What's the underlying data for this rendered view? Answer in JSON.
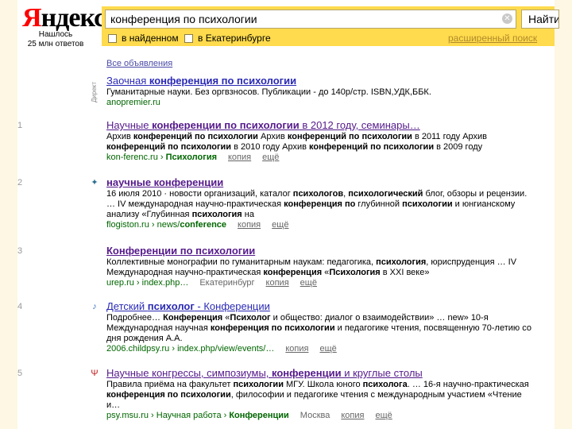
{
  "header": {
    "logo_first": "Я",
    "logo_rest": "ндекс",
    "found_line1": "Нашлось",
    "found_line2": "25 млн ответов",
    "search_value": "конференция по психологии",
    "clear_glyph": "✕",
    "search_button": "Найти",
    "filter_found": "в найденном",
    "filter_city": "в Екатеринбурге",
    "advanced": "расширенный поиск"
  },
  "ads": {
    "all_ads": "Все объявления",
    "label": "Директ",
    "item": {
      "title_pre": "Заочная ",
      "title_bold": "конференция по психологии",
      "snippet": "Гуманитарные науки. Без оргвзносов. Публикации - до 140р/стр. ISBN,УДК,ББК.",
      "url": "anopremier.ru"
    }
  },
  "results": [
    {
      "num": "1",
      "title_pre": "Научные ",
      "title_bold": "конференции по психологии",
      "title_post": " в 2012 году, семинары…",
      "snippet_parts": [
        {
          "t": "Архив ",
          "b": false
        },
        {
          "t": "конференций по психологии",
          "b": true
        },
        {
          "t": " Архив ",
          "b": false
        },
        {
          "t": "конференций по психологии",
          "b": true
        },
        {
          "t": " в 2011 году Архив ",
          "b": false
        },
        {
          "t": "конференций по психологии",
          "b": true
        },
        {
          "t": " в 2010 году Архив ",
          "b": false
        },
        {
          "t": "конференций по психологии",
          "b": true
        },
        {
          "t": " в 2009 году",
          "b": false
        }
      ],
      "url_plain": "kon-ferenc.ru › ",
      "url_bold": "Психология",
      "extras": [
        "копия",
        "ещё"
      ]
    },
    {
      "num": "2",
      "title_pre": "",
      "title_bold": "научные конференции",
      "title_post": "",
      "snippet_parts": [
        {
          "t": "16 июля 2010 · новости организаций, каталог ",
          "b": false
        },
        {
          "t": "психологов",
          "b": true
        },
        {
          "t": ", ",
          "b": false
        },
        {
          "t": "психологический",
          "b": true
        },
        {
          "t": " блог, обзоры и рецензии. … IV международная научно-практическая ",
          "b": false
        },
        {
          "t": "конференция по",
          "b": true
        },
        {
          "t": " глубинной ",
          "b": false
        },
        {
          "t": "психологии",
          "b": true
        },
        {
          "t": " и юнгианскому анализу «Глубинная ",
          "b": false
        },
        {
          "t": "психология",
          "b": true
        },
        {
          "t": " на",
          "b": false
        }
      ],
      "url_plain": "flogiston.ru › news/",
      "url_bold": "conference",
      "extras": [
        "копия",
        "ещё"
      ]
    },
    {
      "num": "3",
      "title_pre": "",
      "title_bold": "Конференции по психологии",
      "title_post": "",
      "snippet_parts": [
        {
          "t": "Коллективные монографии по гуманитарным наукам: педагогика, ",
          "b": false
        },
        {
          "t": "психология",
          "b": true
        },
        {
          "t": ", юриспруденция … IV Международная научно-практическая ",
          "b": false
        },
        {
          "t": "конференция",
          "b": true
        },
        {
          "t": " «",
          "b": false
        },
        {
          "t": "Психология",
          "b": true
        },
        {
          "t": " в XXI веке»",
          "b": false
        }
      ],
      "url_plain": "urep.ru › index.php…",
      "url_bold": "",
      "extras": [
        "Екатеринбург",
        "копия",
        "ещё"
      ]
    },
    {
      "num": "4",
      "title_pre": "Детский ",
      "title_bold": "психолог",
      "title_post": " - Конференции",
      "snippet_parts": [
        {
          "t": "Подробнее… ",
          "b": false
        },
        {
          "t": "Конференция",
          "b": true
        },
        {
          "t": " «",
          "b": false
        },
        {
          "t": "Психолог",
          "b": true
        },
        {
          "t": " и общество: диалог о взаимодействии» … new» 10-я Международная научная ",
          "b": false
        },
        {
          "t": "конференция по психологии",
          "b": true
        },
        {
          "t": " и педагогике чтения, посвященную 70-летию со дня рождения А.А.",
          "b": false
        }
      ],
      "url_plain": "2006.childpsy.ru › index.php/view/events/…",
      "url_bold": "",
      "extras": [
        "копия",
        "ещё"
      ]
    },
    {
      "num": "5",
      "title_pre": "Научные конгрессы, симпозиумы, ",
      "title_bold": "конференции",
      "title_post": " и круглые столы",
      "snippet_parts": [
        {
          "t": "Правила приёма на факультет ",
          "b": false
        },
        {
          "t": "психологии",
          "b": true
        },
        {
          "t": " МГУ. Школа юного ",
          "b": false
        },
        {
          "t": "психолога",
          "b": true
        },
        {
          "t": ". … 16-я научно-практическая ",
          "b": false
        },
        {
          "t": "конференция по психологии",
          "b": true
        },
        {
          "t": ", философии и педагогике чтения с международным участием «Чтение и…",
          "b": false
        }
      ],
      "url_plain": "psy.msu.ru › Научная работа › ",
      "url_bold": "Конференции",
      "extras": [
        "Москва",
        "копия",
        "ещё"
      ]
    }
  ],
  "colors": {
    "bar_yellow": "#ffdb4d",
    "link_blue": "#2a2ab5",
    "url_green": "#006600",
    "logo_red": "#ff0000"
  },
  "icons": [
    "clear-icon",
    "checkbox-icon",
    "favicon-flogiston",
    "favicon-childpsy",
    "favicon-msu"
  ]
}
